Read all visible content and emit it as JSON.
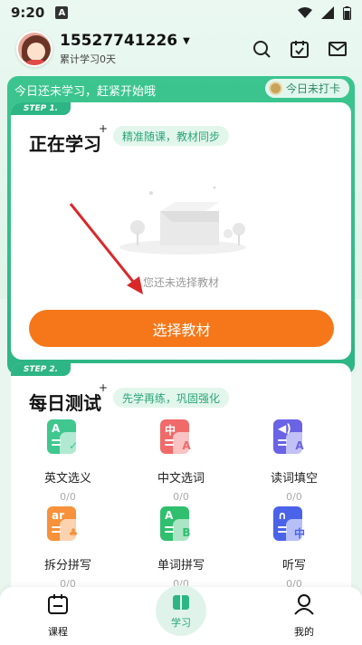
{
  "status_bar": {
    "time": "9:20",
    "notification_letter": "A"
  },
  "header": {
    "phone": "15527741226",
    "days_label": "累计学习0天"
  },
  "banner": {
    "message": "今日还未学习，赶紧开始哦",
    "checkin_label": "今日未打卡"
  },
  "step1": {
    "tag": "STEP 1.",
    "title": "正在学习",
    "spark": "+",
    "pill": "精准随课，教材同步",
    "empty_text": "您还未选择教材",
    "button": "选择教材"
  },
  "step2": {
    "tag": "STEP 2.",
    "title": "每日测试",
    "spark": "+",
    "pill": "先学再练，巩固强化",
    "items": [
      {
        "label": "英文选义",
        "count": "0/0",
        "color": "#3fc78f",
        "glyph": "A",
        "front": "✓"
      },
      {
        "label": "中文选词",
        "count": "0/0",
        "color": "#f06a6a",
        "glyph": "中",
        "front": "A"
      },
      {
        "label": "读词填空",
        "count": "0/0",
        "color": "#6a63e6",
        "glyph": "◀)",
        "front": "A"
      },
      {
        "label": "拆分拼写",
        "count": "0/0",
        "color": "#f7913a",
        "glyph": "ar",
        "front": "♣"
      },
      {
        "label": "单词拼写",
        "count": "0/0",
        "color": "#2fbf6f",
        "glyph": "A",
        "front": "B"
      },
      {
        "label": "听写",
        "count": "0/0",
        "color": "#4b63e8",
        "glyph": "∩",
        "front": "中"
      }
    ]
  },
  "nav": {
    "courses": "课程",
    "study": "学习",
    "mine": "我的"
  },
  "colors": {
    "accent_green": "#2eb585",
    "button_orange": "#f5771a"
  }
}
